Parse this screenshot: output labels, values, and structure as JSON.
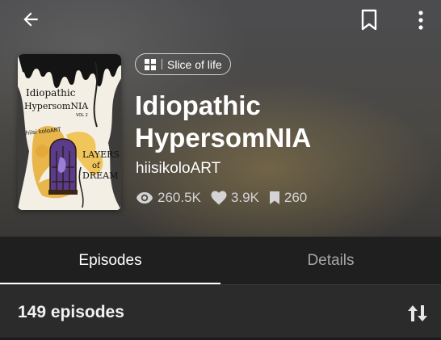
{
  "header": {
    "back_icon": "arrow-left-icon",
    "bookmark_icon": "bookmark-outline-icon",
    "more_icon": "more-vertical-icon"
  },
  "series": {
    "genre_icon": "grid-icon",
    "genre": "Slice of life",
    "title": "Idiopathic HypersomNIA",
    "author": "hiisikoloART",
    "stats": {
      "views": "260.5K",
      "likes": "3.9K",
      "bookmarks": "260"
    },
    "cover_art": {
      "line1": "Idiopathic",
      "line2": "HypersomNIA",
      "vol": "VOL 2",
      "artist": "hiisi koloART",
      "subtitle1": "LAYERS",
      "subtitle2": "of",
      "subtitle3": "DREAM"
    }
  },
  "tabs": [
    {
      "label": "Episodes",
      "active": true
    },
    {
      "label": "Details",
      "active": false
    }
  ],
  "episodes": {
    "count_label": "149 episodes",
    "sort_icon": "sort-arrows-icon"
  },
  "colors": {
    "background": "#1f1f1f",
    "episodes_bar": "#2b2b2b",
    "inactive_tab": "#a6a6a6"
  }
}
